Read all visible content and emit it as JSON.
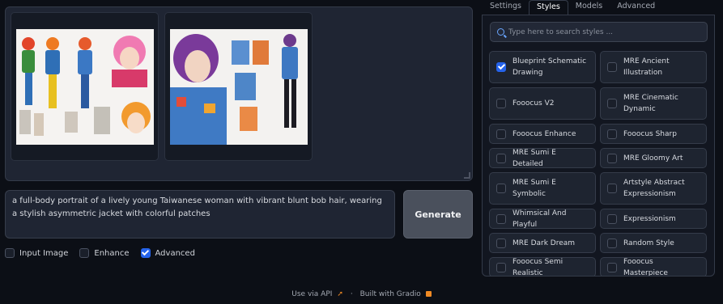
{
  "gallery": {
    "images": [
      {
        "alt": "Fashion illustration sheet with multiple characters in colorful jackets"
      },
      {
        "alt": "Woman with purple bob hair in blue patchwork jacket with outfit sketches"
      }
    ]
  },
  "prompt": {
    "value": "a full-body portrait of a lively young Taiwanese woman with vibrant blunt bob hair, wearing a stylish asymmetric jacket with colorful patches"
  },
  "generate_label": "Generate",
  "options": [
    {
      "label": "Input Image",
      "checked": false
    },
    {
      "label": "Enhance",
      "checked": false
    },
    {
      "label": "Advanced",
      "checked": true
    }
  ],
  "footer": {
    "api": "Use via API",
    "dot": "·",
    "built": "Built with Gradio"
  },
  "tabs": [
    {
      "label": "Settings",
      "active": false
    },
    {
      "label": "Styles",
      "active": true
    },
    {
      "label": "Models",
      "active": false
    },
    {
      "label": "Advanced",
      "active": false
    }
  ],
  "styles_search": {
    "placeholder": "Type here to search styles ..."
  },
  "styles": [
    {
      "label": "Blueprint Schematic Drawing",
      "checked": true
    },
    {
      "label": "MRE Ancient Illustration",
      "checked": false
    },
    {
      "label": "Fooocus V2",
      "checked": false
    },
    {
      "label": "MRE Cinematic Dynamic",
      "checked": false
    },
    {
      "label": "Fooocus Enhance",
      "checked": false
    },
    {
      "label": "Fooocus Sharp",
      "checked": false
    },
    {
      "label": "MRE Sumi E Detailed",
      "checked": false
    },
    {
      "label": "MRE Gloomy Art",
      "checked": false
    },
    {
      "label": "MRE Sumi E Symbolic",
      "checked": false
    },
    {
      "label": "Artstyle Abstract Expressionism",
      "checked": false
    },
    {
      "label": "Whimsical And Playful",
      "checked": false
    },
    {
      "label": "Expressionism",
      "checked": false
    },
    {
      "label": "MRE Dark Dream",
      "checked": false
    },
    {
      "label": "Random Style",
      "checked": false
    },
    {
      "label": "Fooocus Semi Realistic",
      "checked": false
    },
    {
      "label": "Fooocus Masterpiece",
      "checked": false
    }
  ],
  "colors": {
    "accent": "#2563eb",
    "gradio": "#f08a24"
  }
}
